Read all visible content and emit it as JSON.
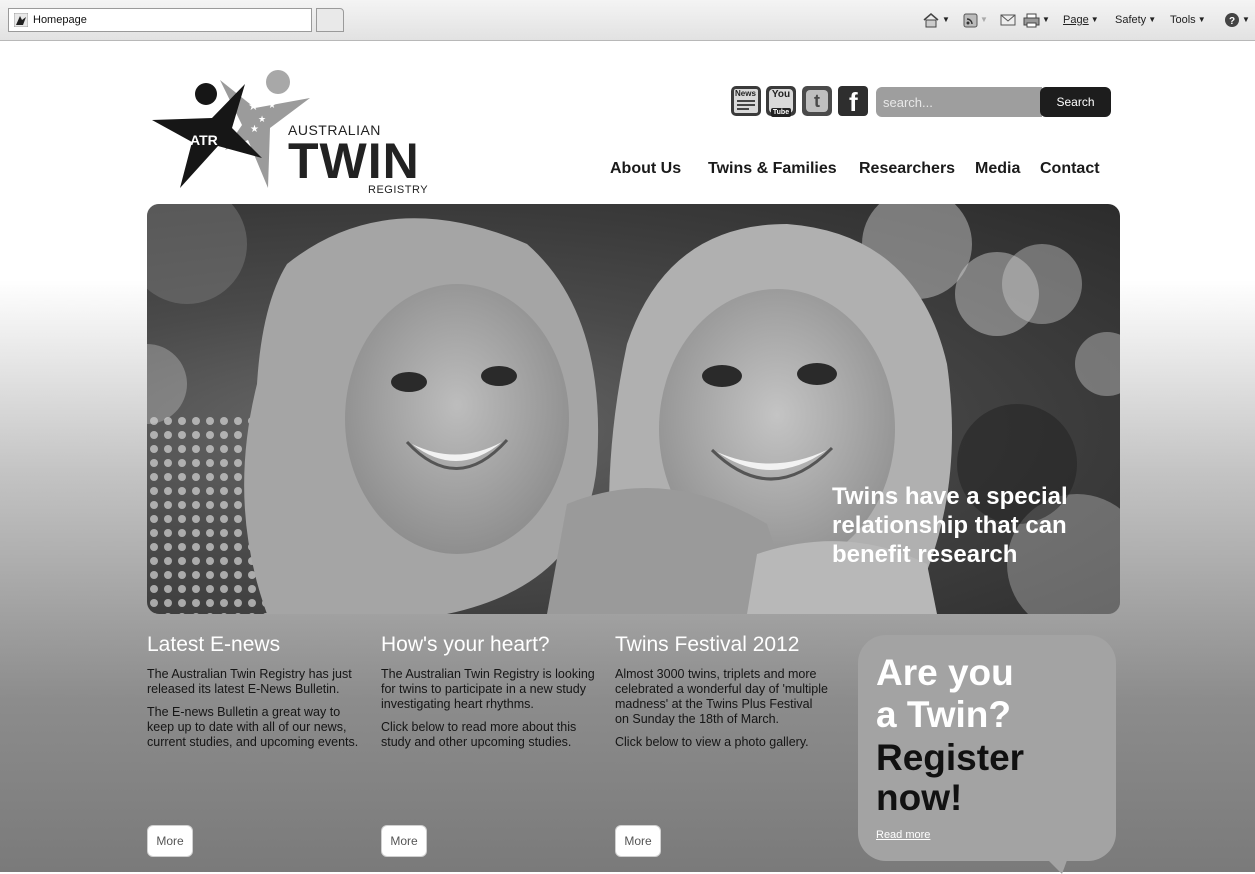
{
  "browser": {
    "tab_title": "Homepage",
    "commands": {
      "page": "Page",
      "safety": "Safety",
      "tools": "Tools"
    },
    "icons": [
      "home-icon",
      "rss-feed-icon",
      "read-mail-icon",
      "print-icon",
      "help-icon"
    ]
  },
  "logo": {
    "badge": "ATR",
    "line1": "AUSTRALIAN",
    "line2": "TWIN",
    "line3": "REGISTRY"
  },
  "social": {
    "news": "News",
    "youtube": "You",
    "youtube_sub": "Tube",
    "twitter": "t",
    "facebook": "f"
  },
  "search": {
    "placeholder": "search...",
    "button": "Search"
  },
  "nav": [
    "About Us",
    "Twins & Families",
    "Researchers",
    "Media",
    "Contact"
  ],
  "hero": {
    "caption": "Twins have a special relationship that can benefit research"
  },
  "columns": [
    {
      "title": "Latest E-news",
      "p1": "The Australian Twin Registry has just released its latest E-News Bulletin.",
      "p2": "The E-news Bulletin a great way to keep up to date with all of our news, current studies, and upcoming events.",
      "button": "More"
    },
    {
      "title": "How's your heart?",
      "p1": "The Australian Twin Registry is looking for twins to participate in a new study investigating heart rhythms.",
      "p2": "Click below to read more about this study and other upcoming studies.",
      "button": "More"
    },
    {
      "title": "Twins Festival 2012",
      "p1": "Almost 3000 twins, triplets and more celebrated a wonderful day of 'multiple madness' at the Twins Plus Festival on Sunday the 18th of March.",
      "p2": "Click below to view a photo gallery.",
      "button": "More"
    }
  ],
  "promo": {
    "line1": "Are you",
    "line2": "a Twin?",
    "line3": "Register",
    "line4": "now!",
    "link": "Read more"
  }
}
